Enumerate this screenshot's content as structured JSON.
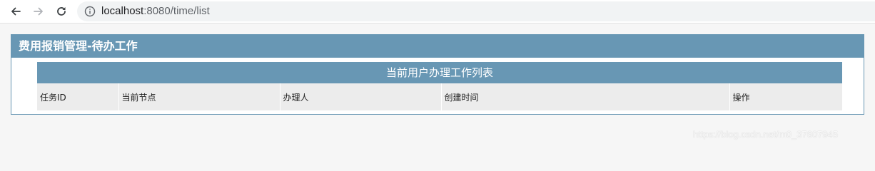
{
  "browser": {
    "url_host": "localhost",
    "url_port_path": ":8080/time/list"
  },
  "panel": {
    "title": "费用报销管理-待办工作"
  },
  "task_table": {
    "caption": "当前用户办理工作列表",
    "columns": [
      "任务ID",
      "当前节点",
      "办理人",
      "创建时间",
      "操作"
    ]
  },
  "watermark": "https://blog.csdn.net/m0_37607945",
  "colors": {
    "header_blue": "#6897b4",
    "column_header_bg": "#ececec"
  },
  "icons": {
    "back": "arrow-left",
    "forward": "arrow-right",
    "reload": "reload",
    "site_info": "info-circle"
  }
}
